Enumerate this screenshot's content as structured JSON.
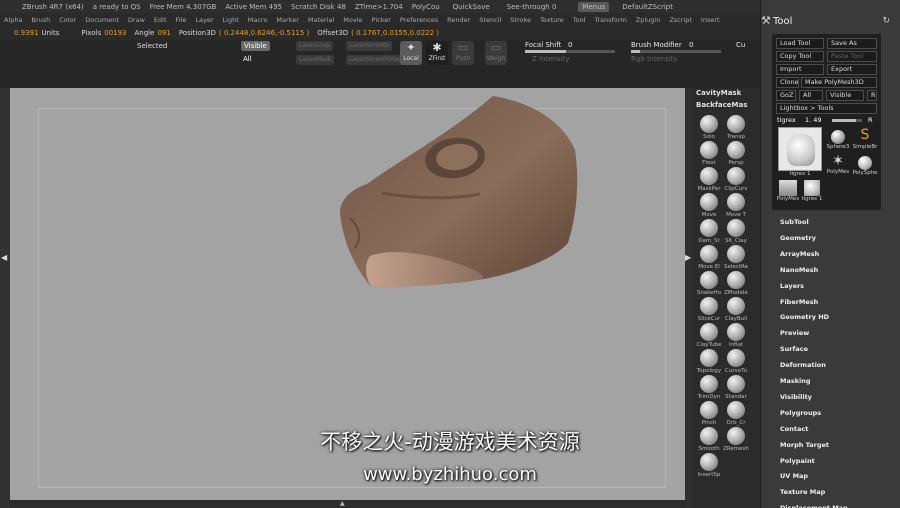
{
  "titlebar": {
    "app": "ZBrush 4R7 (x64)",
    "status": "a ready to QS",
    "free_mem": "Free Mem 4.307GB",
    "active_mem": "Active Mem 495",
    "scratch": "Scratch Disk 48",
    "ztime": "ZTime>1.704",
    "polycount": "PolyCou",
    "quicksave": "QuickSave",
    "see_through": "See-through 0",
    "menus": "Menus",
    "default_script": "DefaultZScript"
  },
  "menubar": [
    "Alpha",
    "Brush",
    "Color",
    "Document",
    "Draw",
    "Edit",
    "File",
    "Layer",
    "Light",
    "Macro",
    "Marker",
    "Material",
    "Movie",
    "Picker",
    "Preferences",
    "Render",
    "Stencil",
    "Stroke",
    "Texture",
    "Tool",
    "Transform",
    "Zplugin",
    "Zscript",
    "Insert"
  ],
  "infobar": {
    "units_value": "0.9391",
    "units_label": "Units",
    "pixols_label": "Pixols",
    "pixols_value": "00193",
    "angle_label": "Angle",
    "angle_value": "091",
    "position_label": "Position3D",
    "position_value": "( 0.2448,0.6246,-0.5115 )",
    "offset_label": "Offset3D",
    "offset_value": "( 0.1767,0.0155,0.0222 )"
  },
  "toolrow": {
    "selected": "Selected",
    "visible": "Visible",
    "all": "All",
    "dim_buttons": [
      "LassoLoop",
      "LassoSmooth",
      "LassoMask",
      "LassoSmoothMask"
    ],
    "local": "Local",
    "zfirst": "ZFirst",
    "push": "Push",
    "weigh": "Weigh",
    "focal_shift_label": "Focal Shift",
    "focal_shift_value": "0",
    "brush_modifier_label": "Brush Modifier",
    "brush_modifier_value": "0",
    "cu": "Cu",
    "z_intensity": "Z Intensity",
    "rgb_intensity": "Rgb Intensity"
  },
  "shelf": {
    "cavity_mask": "CavityMask",
    "backface_mask": "BackfaceMas",
    "items": [
      "Solo",
      "Transp",
      "Floor",
      "Persp",
      "MaskPer",
      "ClipCurv",
      "Move",
      "Move T",
      "Dam_St",
      "SK_Clay",
      "Move El",
      "SelectRe",
      "SnakeHo",
      "ZModele",
      "SliceCur",
      "ClayBuil",
      "ClayTube",
      "Inflat",
      "Topology",
      "CurveTu",
      "TrimDyn",
      "Standar",
      "Pinch",
      "Orb_Cr",
      "Smooth",
      "ZRemesh",
      "InsertSp"
    ]
  },
  "tool_panel": {
    "title": "Tool",
    "load_tool": "Load Tool",
    "save_as": "Save As",
    "copy_tool": "Copy Tool",
    "paste_tool": "Paste Tool",
    "import": "Import",
    "export": "Export",
    "clone": "Clone",
    "make_polymesh": "Make PolyMesh3D",
    "goz": "GoZ",
    "all": "All",
    "visible": "Visible",
    "r": "R",
    "lightbox": "Lightbox > Tools",
    "current_tool_label": "tigrex",
    "current_tool_value": "1. 49",
    "thumbs": [
      "tigrex 1",
      "Sphere3",
      "SimpleBr",
      "PolyMes",
      "PolySphe",
      "PolyMes",
      "tigrex 1"
    ],
    "subpalettes": [
      "SubTool",
      "Geometry",
      "ArrayMesh",
      "NanoMesh",
      "Layers",
      "FiberMesh",
      "Geometry HD",
      "Preview",
      "Surface",
      "Deformation",
      "Masking",
      "Visibility",
      "Polygroups",
      "Contact",
      "Morph Target",
      "Polypaint",
      "UV Map",
      "Texture Map",
      "Displacement Map"
    ]
  },
  "watermark": {
    "line1": "不移之火-动漫游戏美术资源",
    "line2": "www.byzhihuo.com"
  },
  "colors": {
    "accent_value": "#e8a020",
    "canvas": "#a3a3a3",
    "model": "#7a6050"
  }
}
